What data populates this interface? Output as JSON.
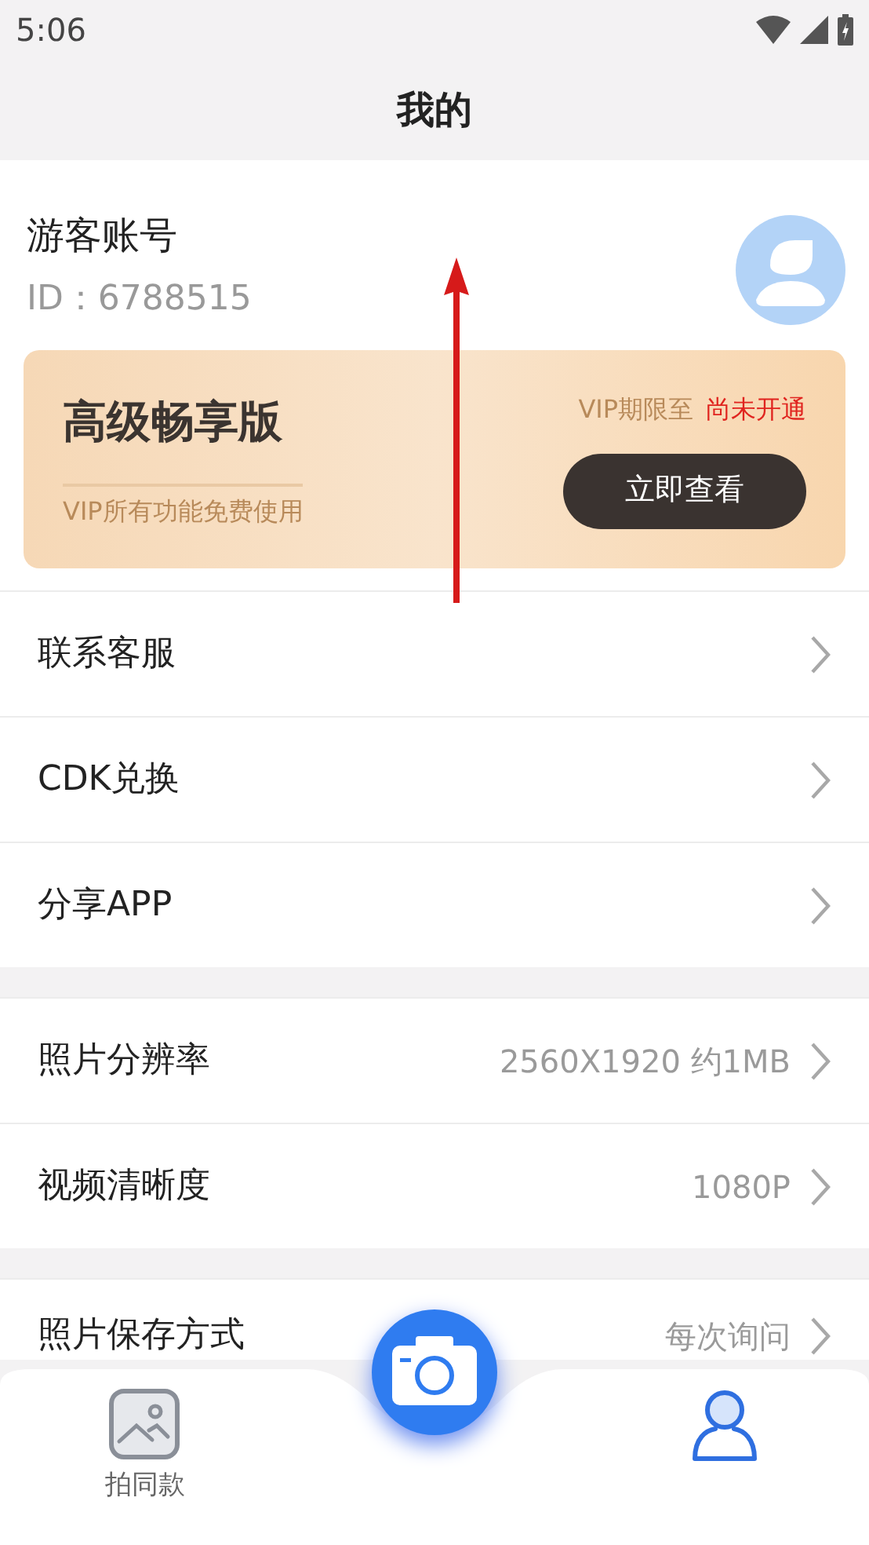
{
  "status_bar": {
    "time": "5:06"
  },
  "header": {
    "title": "我的"
  },
  "profile": {
    "name": "游客账号",
    "id": "ID：6788515"
  },
  "vip_card": {
    "title": "高级畅享版",
    "subtitle": "VIP所有功能免费使用",
    "expiry_label": "VIP期限至",
    "expiry_value": "尚未开通",
    "button": "立即查看"
  },
  "menu_groups": [
    {
      "items": [
        {
          "label": "联系客服"
        },
        {
          "label": "CDK兑换"
        },
        {
          "label": "分享APP"
        }
      ]
    },
    {
      "items": [
        {
          "label": "照片分辨率",
          "value": "2560X1920 约1MB"
        },
        {
          "label": "视频清晰度",
          "value": "1080P"
        }
      ]
    },
    {
      "items": [
        {
          "label": "照片保存方式",
          "value": "每次询问"
        }
      ]
    }
  ],
  "bottom_nav": {
    "tabs": [
      {
        "kind": "gallery",
        "label": "拍同款",
        "selected": false
      },
      {
        "kind": "camera",
        "selected": false
      },
      {
        "kind": "profile",
        "selected": true
      }
    ]
  }
}
